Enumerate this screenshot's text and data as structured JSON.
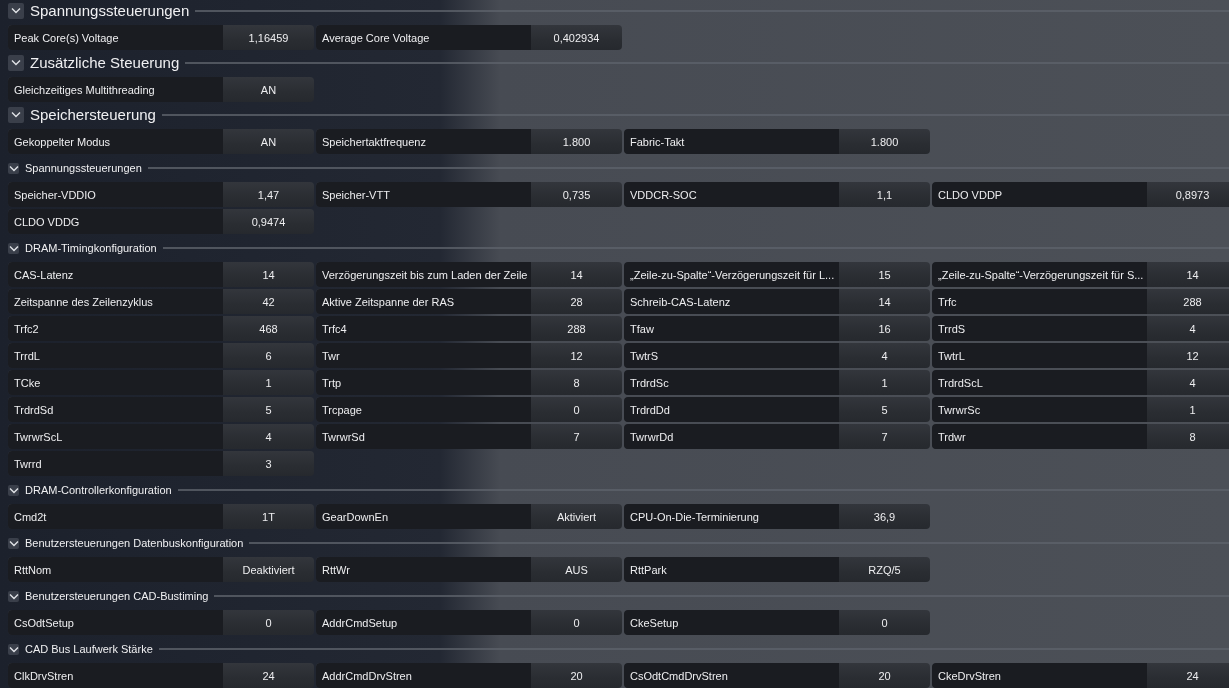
{
  "sections": [
    {
      "kind": "major",
      "title": "Spannungssteuerungen",
      "expanded": true,
      "fields": [
        {
          "label": "Peak Core(s) Voltage",
          "value": "1,16459"
        },
        {
          "label": "Average Core Voltage",
          "value": "0,402934"
        }
      ]
    },
    {
      "kind": "major",
      "title": "Zusätzliche Steuerung",
      "expanded": true,
      "fields": [
        {
          "label": "Gleichzeitiges Multithreading",
          "value": "AN"
        }
      ]
    },
    {
      "kind": "major",
      "title": "Speichersteuerung",
      "expanded": true,
      "fields": [
        {
          "label": "Gekoppelter Modus",
          "value": "AN"
        },
        {
          "label": "Speichertaktfrequenz",
          "value": "1.800"
        },
        {
          "label": "Fabric-Takt",
          "value": "1.800"
        }
      ]
    },
    {
      "kind": "minor",
      "title": "Spannungssteuerungen",
      "expanded": true,
      "fields": [
        {
          "label": "Speicher-VDDIO",
          "value": "1,47"
        },
        {
          "label": "Speicher-VTT",
          "value": "0,735"
        },
        {
          "label": "VDDCR-SOC",
          "value": "1,1"
        },
        {
          "label": "CLDO VDDP",
          "value": "0,8973"
        },
        {
          "label": "CLDO VDDG",
          "value": "0,9474"
        }
      ]
    },
    {
      "kind": "minor",
      "title": "DRAM-Timingkonfiguration",
      "expanded": true,
      "fields": [
        {
          "label": "CAS-Latenz",
          "value": "14"
        },
        {
          "label": "Verzögerungszeit bis zum Laden der Zeile",
          "value": "14"
        },
        {
          "label": "„Zeile-zu-Spalte“-Verzögerungszeit für L...",
          "value": "15"
        },
        {
          "label": "„Zeile-zu-Spalte“-Verzögerungszeit für S...",
          "value": "14"
        },
        {
          "label": "Zeitspanne des Zeilenzyklus",
          "value": "42"
        },
        {
          "label": "Aktive Zeitspanne der RAS",
          "value": "28"
        },
        {
          "label": "Schreib-CAS-Latenz",
          "value": "14"
        },
        {
          "label": "Trfc",
          "value": "288"
        },
        {
          "label": "Trfc2",
          "value": "468"
        },
        {
          "label": "Trfc4",
          "value": "288"
        },
        {
          "label": "Tfaw",
          "value": "16"
        },
        {
          "label": "TrrdS",
          "value": "4"
        },
        {
          "label": "TrrdL",
          "value": "6"
        },
        {
          "label": "Twr",
          "value": "12"
        },
        {
          "label": "TwtrS",
          "value": "4"
        },
        {
          "label": "TwtrL",
          "value": "12"
        },
        {
          "label": "TCke",
          "value": "1"
        },
        {
          "label": "Trtp",
          "value": "8"
        },
        {
          "label": "TrdrdSc",
          "value": "1"
        },
        {
          "label": "TrdrdScL",
          "value": "4"
        },
        {
          "label": "TrdrdSd",
          "value": "5"
        },
        {
          "label": "Trcpage",
          "value": "0"
        },
        {
          "label": "TrdrdDd",
          "value": "5"
        },
        {
          "label": "TwrwrSc",
          "value": "1"
        },
        {
          "label": "TwrwrScL",
          "value": "4"
        },
        {
          "label": "TwrwrSd",
          "value": "7"
        },
        {
          "label": "TwrwrDd",
          "value": "7"
        },
        {
          "label": "Trdwr",
          "value": "8"
        },
        {
          "label": "Twrrd",
          "value": "3"
        }
      ]
    },
    {
      "kind": "minor",
      "title": "DRAM-Controllerkonfiguration",
      "expanded": true,
      "fields": [
        {
          "label": "Cmd2t",
          "value": "1T"
        },
        {
          "label": "GearDownEn",
          "value": "Aktiviert"
        },
        {
          "label": "CPU-On-Die-Terminierung",
          "value": "36,9"
        }
      ]
    },
    {
      "kind": "minor",
      "title": "Benutzersteuerungen Datenbuskonfiguration",
      "expanded": true,
      "fields": [
        {
          "label": "RttNom",
          "value": "Deaktiviert"
        },
        {
          "label": "RttWr",
          "value": "AUS"
        },
        {
          "label": "RttPark",
          "value": "RZQ/5"
        }
      ]
    },
    {
      "kind": "minor",
      "title": "Benutzersteuerungen CAD-Bustiming",
      "expanded": true,
      "fields": [
        {
          "label": "CsOdtSetup",
          "value": "0"
        },
        {
          "label": "AddrCmdSetup",
          "value": "0"
        },
        {
          "label": "CkeSetup",
          "value": "0"
        }
      ]
    },
    {
      "kind": "minor",
      "title": "CAD Bus Laufwerk Stärke",
      "expanded": true,
      "fields": [
        {
          "label": "ClkDrvStren",
          "value": "24"
        },
        {
          "label": "AddrCmdDrvStren",
          "value": "20"
        },
        {
          "label": "CsOdtCmdDrvStren",
          "value": "20"
        },
        {
          "label": "CkeDrvStren",
          "value": "24"
        }
      ]
    }
  ]
}
